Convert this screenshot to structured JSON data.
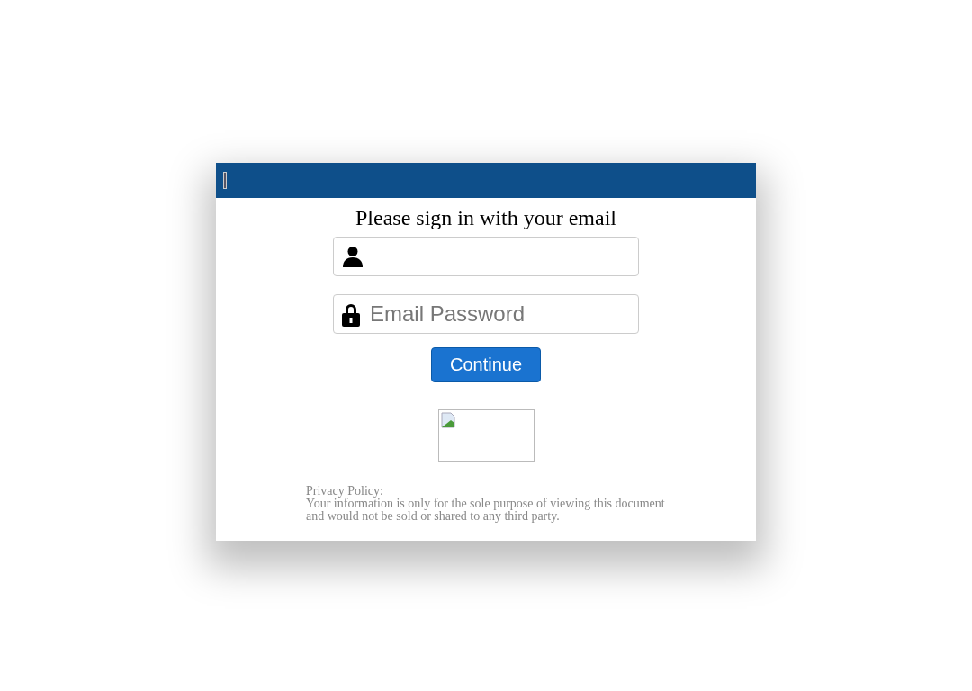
{
  "dialog": {
    "heading": "Please sign in with your email",
    "fields": [
      {
        "kind": "email"
      },
      {
        "kind": "password",
        "placeholder": "Email Password"
      }
    ],
    "button": "Continue",
    "privacy": {
      "title": "Privacy Policy:",
      "text": "Your information is only for the sole purpose of viewing this document and would not be sold or shared to any third party."
    }
  }
}
